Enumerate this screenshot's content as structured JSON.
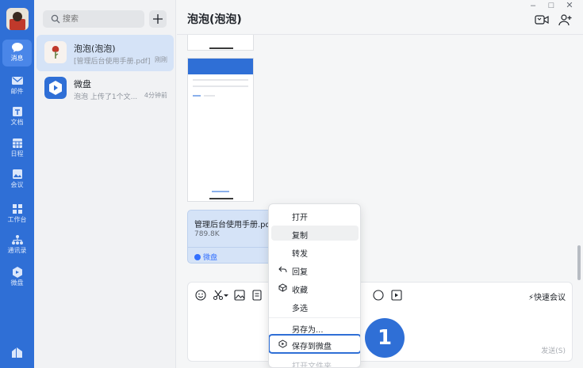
{
  "nav": {
    "items": [
      {
        "label": "消息",
        "icon": "message-icon"
      },
      {
        "label": "邮件",
        "icon": "mail-icon"
      },
      {
        "label": "文档",
        "icon": "document-icon"
      },
      {
        "label": "日程",
        "icon": "calendar-icon"
      },
      {
        "label": "会议",
        "icon": "meeting-icon"
      },
      {
        "label": "工作台",
        "icon": "workbench-icon"
      },
      {
        "label": "通讯录",
        "icon": "contacts-icon"
      },
      {
        "label": "微盘",
        "icon": "weipan-icon"
      }
    ]
  },
  "search": {
    "placeholder": "搜索"
  },
  "sessions": [
    {
      "name": "泡泡(泡泡)",
      "preview": "[管理后台使用手册.pdf]",
      "time": "刚刚"
    },
    {
      "name": "微盘",
      "preview": "泡泡 上传了1个文...",
      "time": "4分钟前"
    }
  ],
  "chat": {
    "title": "泡泡(泡泡)",
    "file": {
      "name": "管理后台使用手册.pdf",
      "size": "789.8K",
      "source": "微盘"
    }
  },
  "composer": {
    "quick_meeting": "快速会议",
    "send": "发送(S)"
  },
  "context_menu": {
    "items": [
      {
        "label": "打开"
      },
      {
        "label": "复制"
      },
      {
        "label": "转发"
      },
      {
        "label": "回复"
      },
      {
        "label": "收藏"
      },
      {
        "label": "多选"
      },
      {
        "label": "另存为..."
      },
      {
        "label": "保存到微盘"
      },
      {
        "label": "打开文件夹"
      }
    ]
  },
  "annotation": {
    "step": "1"
  },
  "colors": {
    "accent": "#2f6fd6",
    "active_session": "#d5e3f7",
    "badge": "#2f6fd6"
  }
}
